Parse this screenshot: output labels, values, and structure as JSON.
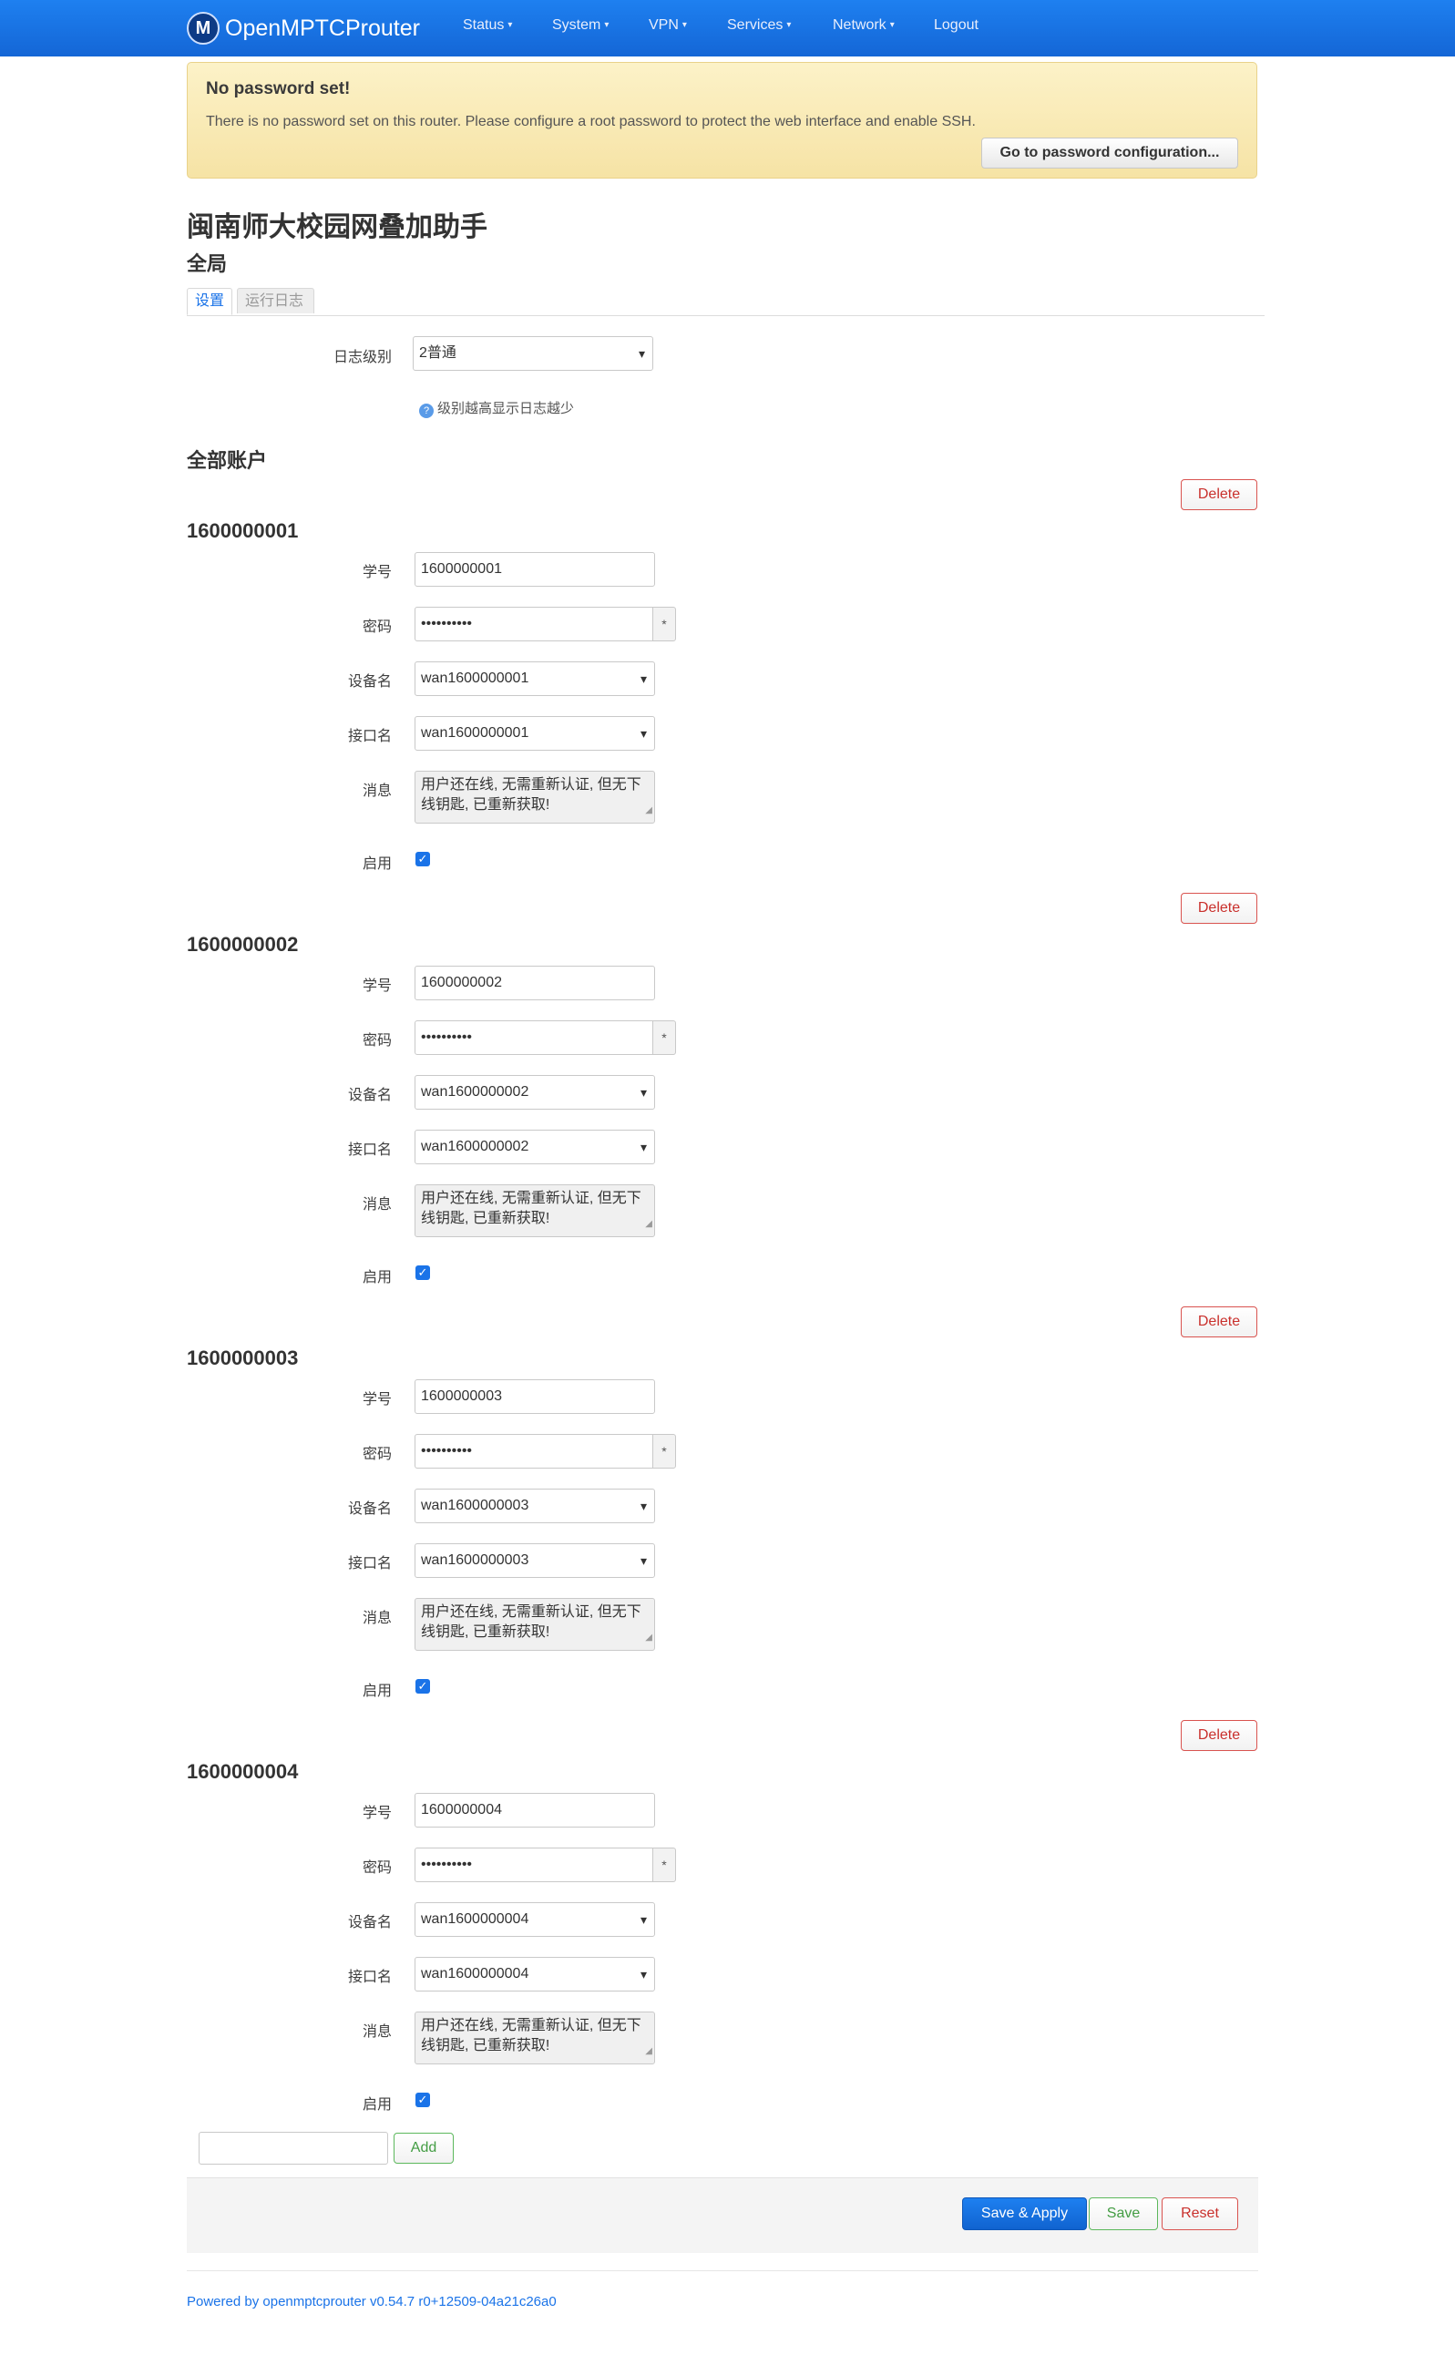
{
  "nav": {
    "brand": "OpenMPTCProuter",
    "logo_glyph": "M",
    "items": [
      {
        "label": "Status",
        "dropdown": true
      },
      {
        "label": "System",
        "dropdown": true
      },
      {
        "label": "VPN",
        "dropdown": true
      },
      {
        "label": "Services",
        "dropdown": true
      },
      {
        "label": "Network",
        "dropdown": true
      },
      {
        "label": "Logout",
        "dropdown": false
      }
    ],
    "caret": "▾"
  },
  "alert": {
    "title": "No password set!",
    "message": "There is no password set on this router. Please configure a root password to protect the web interface and enable SSH.",
    "button": "Go to password configuration..."
  },
  "page": {
    "title": "闽南师大校园网叠加助手",
    "section": "全局",
    "tabs": [
      "设置",
      "运行日志"
    ]
  },
  "global": {
    "log_level_label": "日志级别",
    "log_level_value": "2普通",
    "log_level_hint": "级别越高显示日志越少",
    "hint_icon": "?"
  },
  "accounts_section_title": "全部账户",
  "labels": {
    "student_id": "学号",
    "password": "密码",
    "device": "设备名",
    "interface": "接口名",
    "message": "消息",
    "enabled": "启用",
    "delete": "Delete",
    "password_mask": "••••••••••",
    "reveal": "*"
  },
  "accounts": [
    {
      "title": "1600000001",
      "student_id": "1600000001",
      "device": "wan1600000001",
      "interface": "wan1600000001",
      "message": "用户还在线, 无需重新认证, 但无下线钥匙, 已重新获取!",
      "enabled": true
    },
    {
      "title": "1600000002",
      "student_id": "1600000002",
      "device": "wan1600000002",
      "interface": "wan1600000002",
      "message": "用户还在线, 无需重新认证, 但无下线钥匙, 已重新获取!",
      "enabled": true
    },
    {
      "title": "1600000003",
      "student_id": "1600000003",
      "device": "wan1600000003",
      "interface": "wan1600000003",
      "message": "用户还在线, 无需重新认证, 但无下线钥匙, 已重新获取!",
      "enabled": true
    },
    {
      "title": "1600000004",
      "student_id": "1600000004",
      "device": "wan1600000004",
      "interface": "wan1600000004",
      "message": "用户还在线, 无需重新认证, 但无下线钥匙, 已重新获取!",
      "enabled": true
    }
  ],
  "add_button": "Add",
  "actions": {
    "save_apply": "Save & Apply",
    "save": "Save",
    "reset": "Reset"
  },
  "footer": "Powered by openmptcprouter v0.54.7 r0+12509-04a21c26a0",
  "colors": {
    "primary": "#1a73e8",
    "danger": "#d9534f",
    "success": "#5cb85c",
    "alert_bg": "#f6e3a5"
  }
}
